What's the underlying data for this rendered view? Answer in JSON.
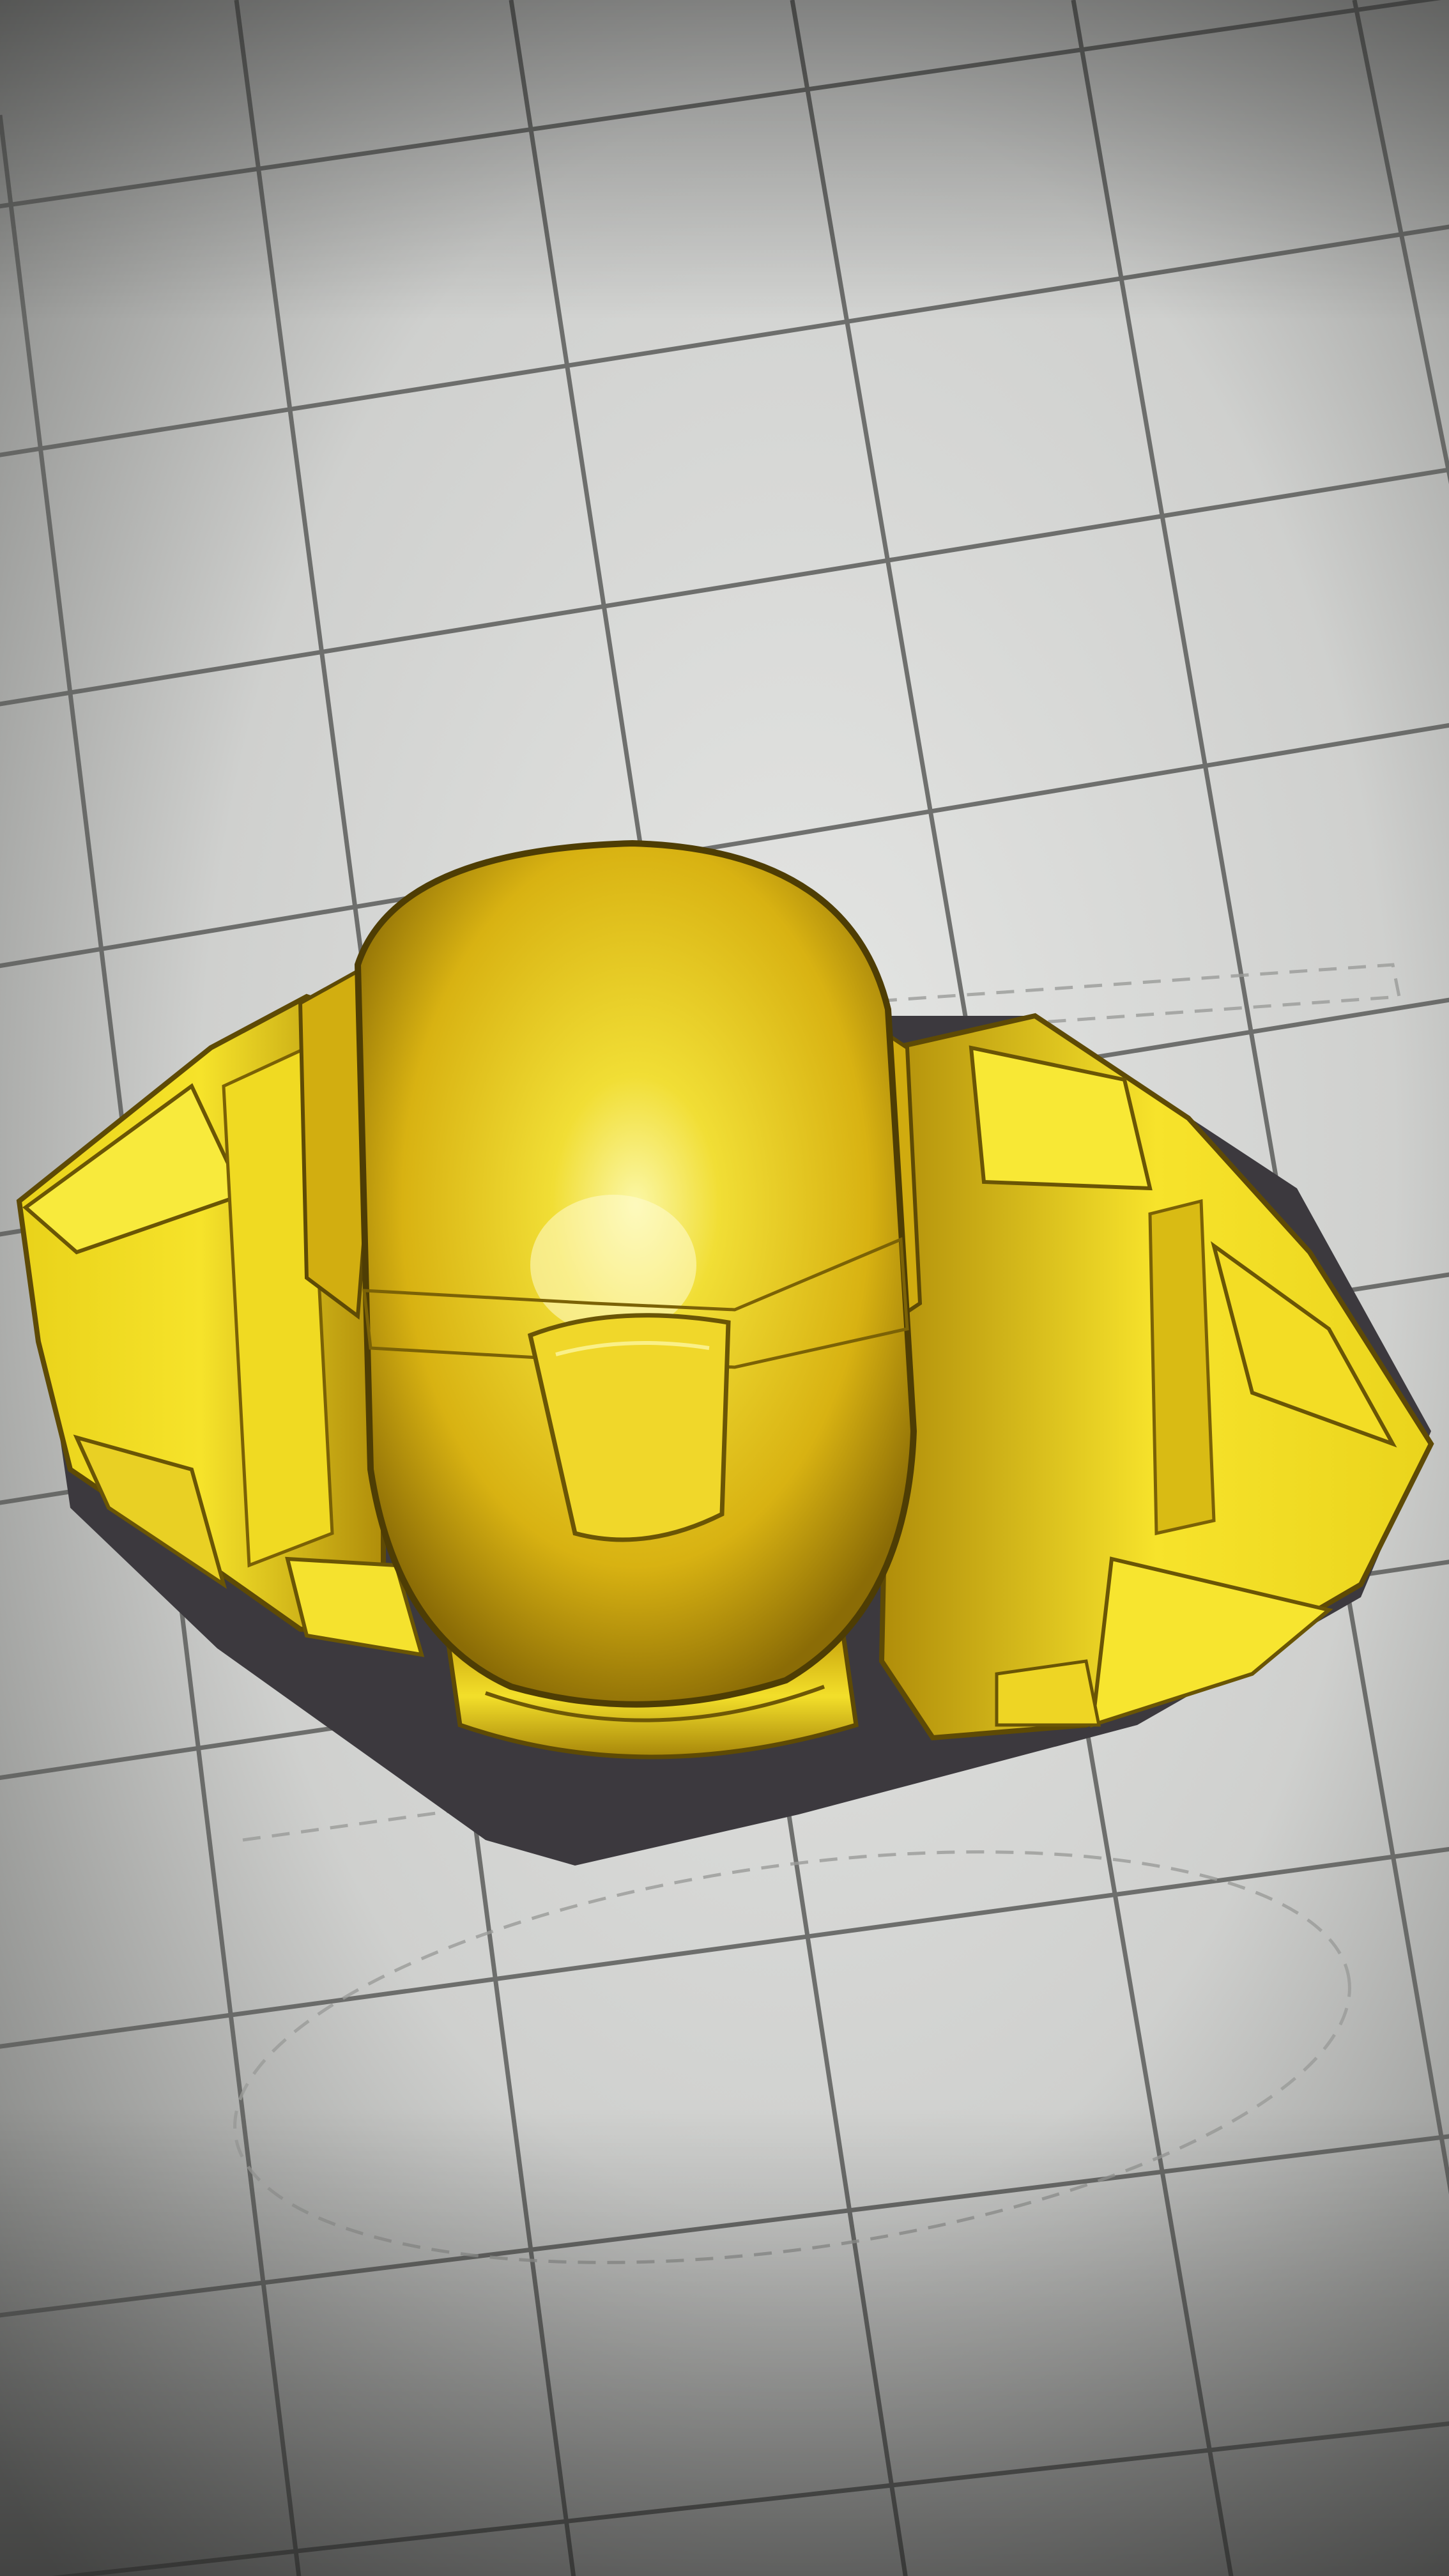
{
  "viewport": {
    "kind": "3d-build-plate-view",
    "grid": "on",
    "model": "helmet-bust",
    "colors": {
      "plate_light": "#d9dad8",
      "plate_dark": "#7d7e7c",
      "grid_line": "#5f605e",
      "model_yellow": "#f2d81a",
      "model_highlight": "#fbf59a",
      "model_shadow": "#8a6d05",
      "cast_shadow": "#3d3a3f"
    }
  }
}
